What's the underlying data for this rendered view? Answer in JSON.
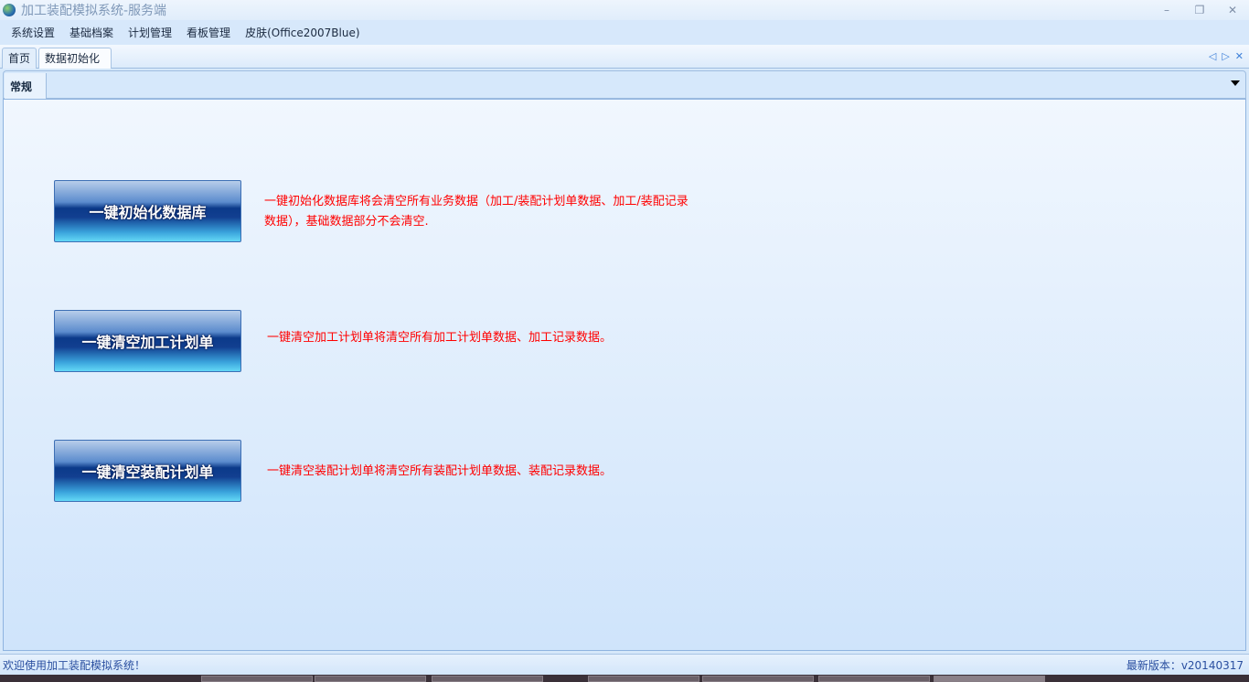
{
  "window": {
    "title": "加工装配模拟系统-服务端",
    "minimize": "–",
    "restore": "❐",
    "close": "✕"
  },
  "menu": [
    "系统设置",
    "基础档案",
    "计划管理",
    "看板管理",
    "皮肤(Office2007Blue)"
  ],
  "tabs": [
    {
      "label": "首页"
    },
    {
      "label": "数据初始化"
    }
  ],
  "tab_nav": {
    "prev": "◁",
    "next": "▷",
    "close": "✕"
  },
  "inner_tab": "常规",
  "actions": [
    {
      "button": "一键初始化数据库",
      "desc": "一键初始化数据库将会清空所有业务数据（加工/装配计划单数据、加工/装配记录数据），基础数据部分不会清空."
    },
    {
      "button": "一键清空加工计划单",
      "desc": "一键清空加工计划单将清空所有加工计划单数据、加工记录数据。"
    },
    {
      "button": "一键清空装配计划单",
      "desc": "一键清空装配计划单将清空所有装配计划单数据、装配记录数据。"
    }
  ],
  "status": {
    "welcome": "欢迎使用加工装配模拟系统！",
    "version": "最新版本：v20140317"
  }
}
